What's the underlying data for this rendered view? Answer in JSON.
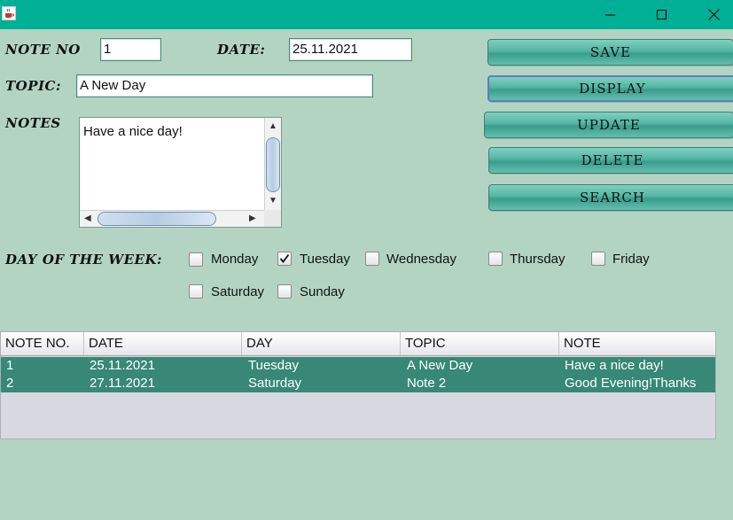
{
  "window": {
    "title": "",
    "icons": {
      "app": "java-cup-icon",
      "minimize": "minimize-icon",
      "maximize": "maximize-icon",
      "close": "close-icon"
    }
  },
  "form": {
    "note_no_label": "NOTE NO",
    "note_no_value": "1",
    "date_label": "DATE:",
    "date_value": "25.11.2021",
    "topic_label": "TOPIC:",
    "topic_value": "A New Day",
    "notes_label": "NOTES",
    "notes_value": "Have a nice day!"
  },
  "buttons": {
    "save": "SAVE",
    "display": "DISPLAY",
    "update": "UPDATE",
    "delete": "DELETE",
    "search": "SEARCH"
  },
  "days": {
    "label": "DAY OF THE WEEK:",
    "items": [
      {
        "name": "Monday",
        "checked": false
      },
      {
        "name": "Tuesday",
        "checked": true
      },
      {
        "name": "Wednesday",
        "checked": false
      },
      {
        "name": "Thursday",
        "checked": false
      },
      {
        "name": "Friday",
        "checked": false
      },
      {
        "name": "Saturday",
        "checked": false
      },
      {
        "name": "Sunday",
        "checked": false
      }
    ]
  },
  "table": {
    "columns": [
      "NOTE NO.",
      "DATE",
      "DAY",
      "TOPIC",
      "NOTE"
    ],
    "rows": [
      [
        "1",
        "25.11.2021",
        "Tuesday",
        "A New Day",
        "Have a nice day!"
      ],
      [
        "2",
        "27.11.2021",
        "Saturday",
        "Note 2",
        "Good Evening!Thanks"
      ]
    ]
  },
  "colors": {
    "titlebar": "#00b096",
    "background": "#b3d4c3",
    "selected_row": "#378876",
    "button": "#54b4a3"
  }
}
